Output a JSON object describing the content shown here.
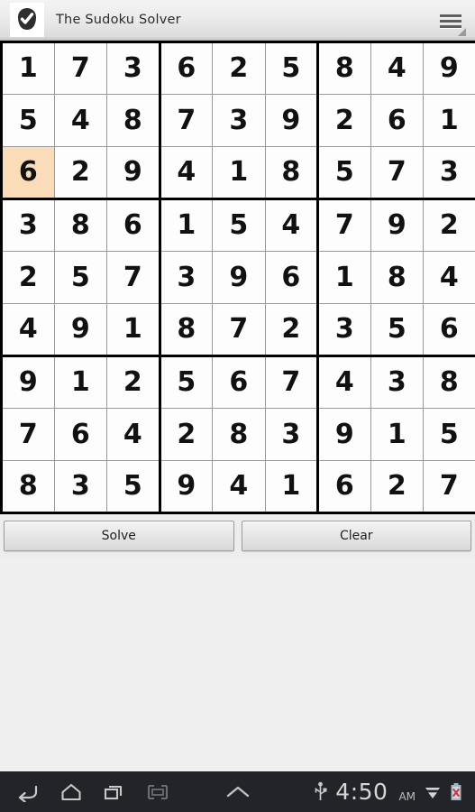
{
  "titlebar": {
    "app_icon": "check-badge-icon",
    "title": "The Sudoku Solver",
    "menu_icon": "hamburger-menu-icon"
  },
  "colors": {
    "selected_cell_bg": "#fadcb8",
    "grid_line": "#9a9a9a",
    "grid_block_line": "#000000",
    "page_bg": "#efefef",
    "navbar_bg": "#222427",
    "navbar_fg": "#d6d6d6"
  },
  "board": {
    "selected_cell": {
      "row": 2,
      "col": 0
    },
    "rows": [
      [
        "1",
        "7",
        "3",
        "6",
        "2",
        "5",
        "8",
        "4",
        "9"
      ],
      [
        "5",
        "4",
        "8",
        "7",
        "3",
        "9",
        "2",
        "6",
        "1"
      ],
      [
        "6",
        "2",
        "9",
        "4",
        "1",
        "8",
        "5",
        "7",
        "3"
      ],
      [
        "3",
        "8",
        "6",
        "1",
        "5",
        "4",
        "7",
        "9",
        "2"
      ],
      [
        "2",
        "5",
        "7",
        "3",
        "9",
        "6",
        "1",
        "8",
        "4"
      ],
      [
        "4",
        "9",
        "1",
        "8",
        "7",
        "2",
        "3",
        "5",
        "6"
      ],
      [
        "9",
        "1",
        "2",
        "5",
        "6",
        "7",
        "4",
        "3",
        "8"
      ],
      [
        "7",
        "6",
        "4",
        "2",
        "8",
        "3",
        "9",
        "1",
        "5"
      ],
      [
        "8",
        "3",
        "5",
        "9",
        "4",
        "1",
        "6",
        "2",
        "7"
      ]
    ]
  },
  "buttons": {
    "solve_label": "Solve",
    "clear_label": "Clear"
  },
  "navbar": {
    "back_icon": "back-arrow-icon",
    "home_icon": "home-icon",
    "recents_icon": "recent-apps-icon",
    "screenshot_icon": "screenshot-icon",
    "expand_icon": "caret-up-icon",
    "usb_icon": "usb-icon",
    "time": "4:50",
    "meridiem": "AM",
    "signal_icon": "signal-icon",
    "battery_icon": "battery-error-icon"
  }
}
